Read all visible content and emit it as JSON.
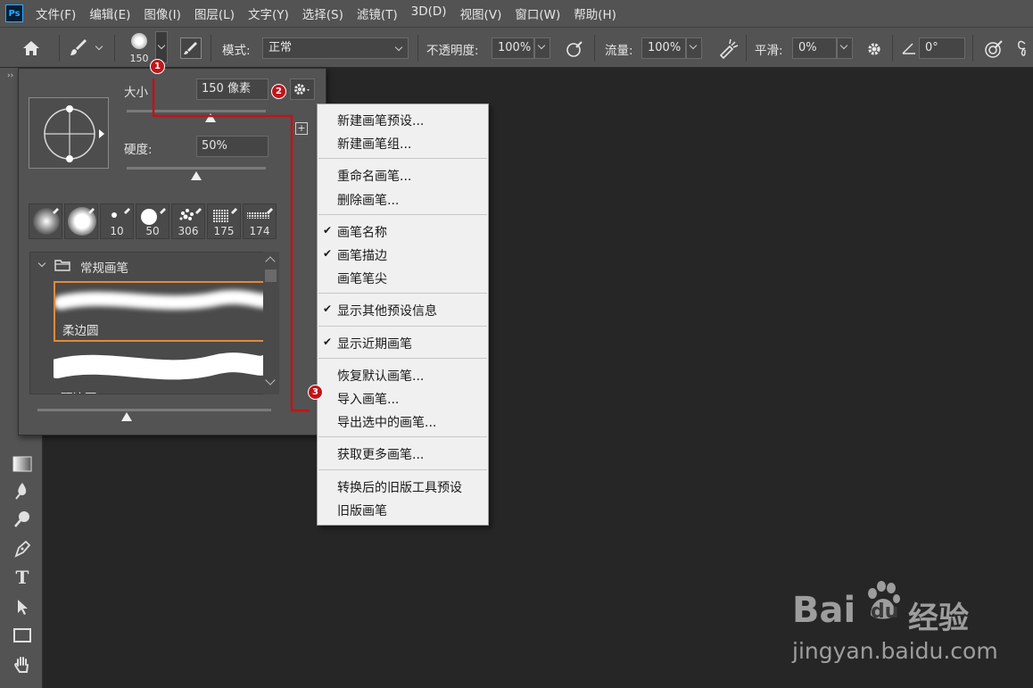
{
  "app": {
    "logo": "Ps"
  },
  "menubar": {
    "items": [
      "文件(F)",
      "编辑(E)",
      "图像(I)",
      "图层(L)",
      "文字(Y)",
      "选择(S)",
      "滤镜(T)",
      "3D(D)",
      "视图(V)",
      "窗口(W)",
      "帮助(H)"
    ]
  },
  "options_bar": {
    "brush_size_label": "150",
    "mode_label": "模式:",
    "mode_value": "正常",
    "opacity_label": "不透明度:",
    "opacity_value": "100%",
    "flow_label": "流量:",
    "flow_value": "100%",
    "smooth_label": "平滑:",
    "smooth_value": "0%",
    "angle_value": "0°"
  },
  "brush_panel": {
    "size_label": "大小",
    "size_value": "150 像素",
    "size_level": 0.6,
    "hardness_label": "硬度:",
    "hardness_value": "50%",
    "hardness_level": 0.5,
    "recent_brushes": [
      {
        "size": ""
      },
      {
        "size": ""
      },
      {
        "size": "10"
      },
      {
        "size": "50"
      },
      {
        "size": "306"
      },
      {
        "size": "175"
      },
      {
        "size": "174"
      }
    ],
    "group_name": "常规画笔",
    "brushes": [
      {
        "name": "柔边圆",
        "selected": true
      },
      {
        "name": "硬边圆",
        "selected": false
      }
    ]
  },
  "context_menu": {
    "groups": [
      [
        {
          "label": "新建画笔预设...",
          "checked": false
        },
        {
          "label": "新建画笔组...",
          "checked": false
        }
      ],
      [
        {
          "label": "重命名画笔...",
          "checked": false
        },
        {
          "label": "删除画笔...",
          "checked": false
        }
      ],
      [
        {
          "label": "画笔名称",
          "checked": true
        },
        {
          "label": "画笔描边",
          "checked": true
        },
        {
          "label": "画笔笔尖",
          "checked": false
        }
      ],
      [
        {
          "label": "显示其他预设信息",
          "checked": true
        }
      ],
      [
        {
          "label": "显示近期画笔",
          "checked": true
        }
      ],
      [
        {
          "label": "恢复默认画笔...",
          "checked": false
        },
        {
          "label": "导入画笔...",
          "checked": false
        },
        {
          "label": "导出选中的画笔...",
          "checked": false
        }
      ],
      [
        {
          "label": "获取更多画笔...",
          "checked": false
        }
      ],
      [
        {
          "label": "转换后的旧版工具预设",
          "checked": false
        },
        {
          "label": "旧版画笔",
          "checked": false
        }
      ]
    ]
  },
  "callouts": [
    "1",
    "2",
    "3"
  ],
  "colors": {
    "callout": "#c0141a",
    "selection": "#e08a3a",
    "panel": "#535353",
    "canvas": "#262626"
  },
  "watermark": {
    "brand": "Bai",
    "brand2": "du",
    "cn": "经验",
    "url": "jingyan.baidu.com"
  }
}
